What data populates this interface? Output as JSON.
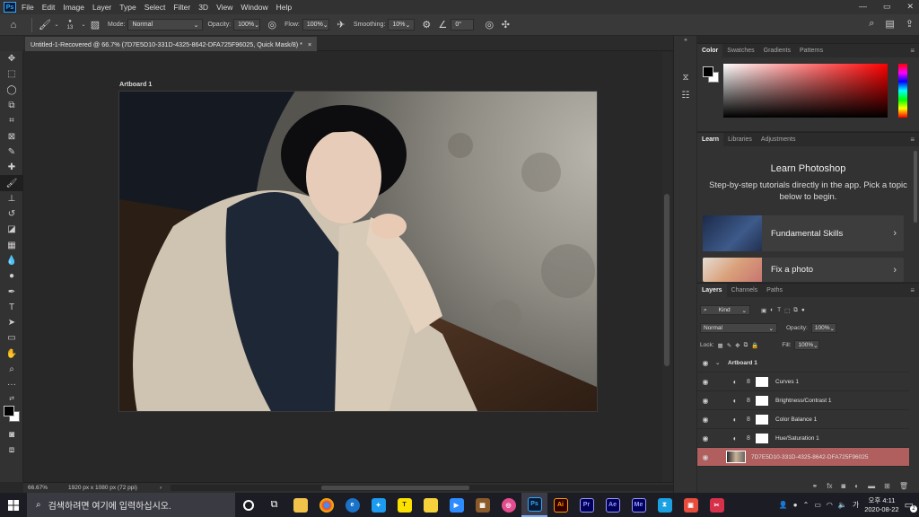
{
  "menu": {
    "app_badge": "Ps",
    "items": [
      "File",
      "Edit",
      "Image",
      "Layer",
      "Type",
      "Select",
      "Filter",
      "3D",
      "View",
      "Window",
      "Help"
    ]
  },
  "options": {
    "brush_size": "13",
    "mode_label": "Mode:",
    "mode_value": "Normal",
    "opacity_label": "Opacity:",
    "opacity_value": "100%",
    "flow_label": "Flow:",
    "flow_value": "100%",
    "smoothing_label": "Smoothing:",
    "smoothing_value": "10%",
    "angle_value": "0°"
  },
  "document": {
    "tab_title": "Untitled-1-Recovered @ 66.7% (7D7E5D10-331D-4325-8642-DFA725F96025, Quick Mask/8) *",
    "tab_close": "×",
    "artboard_label": "Artboard 1",
    "zoom": "66.67%",
    "doc_info": "1920 px x 1080 px (72 ppi)"
  },
  "color_panel": {
    "tabs": [
      "Color",
      "Swatches",
      "Gradients",
      "Patterns"
    ],
    "foreground": "#000000",
    "background": "#ffffff",
    "hue_color": "#ff0000"
  },
  "learn_panel": {
    "tabs": [
      "Learn",
      "Libraries",
      "Adjustments"
    ],
    "title": "Learn Photoshop",
    "description": "Step-by-step tutorials directly in the app. Pick a topic below to begin.",
    "cards": [
      "Fundamental Skills",
      "Fix a photo"
    ]
  },
  "layers_panel": {
    "tabs": [
      "Layers",
      "Channels",
      "Paths"
    ],
    "filter_value": "Kind",
    "blend_mode": "Normal",
    "opacity_label": "Opacity:",
    "opacity_value": "100%",
    "lock_label": "Lock:",
    "fill_label": "Fill:",
    "fill_value": "100%",
    "group_name": "Artboard 1",
    "layers": [
      "Curves 1",
      "Brightness/Contrast 1",
      "Color Balance 1",
      "Hue/Saturation 1"
    ],
    "image_layer": "7D7E5D10-331D-4325-8642-DFA725F96025"
  },
  "taskbar": {
    "search_placeholder": "검색하려면 여기에 입력하십시오.",
    "clock_time": "오후 4:11",
    "clock_date": "2020-08-22",
    "notification_count": "2"
  }
}
